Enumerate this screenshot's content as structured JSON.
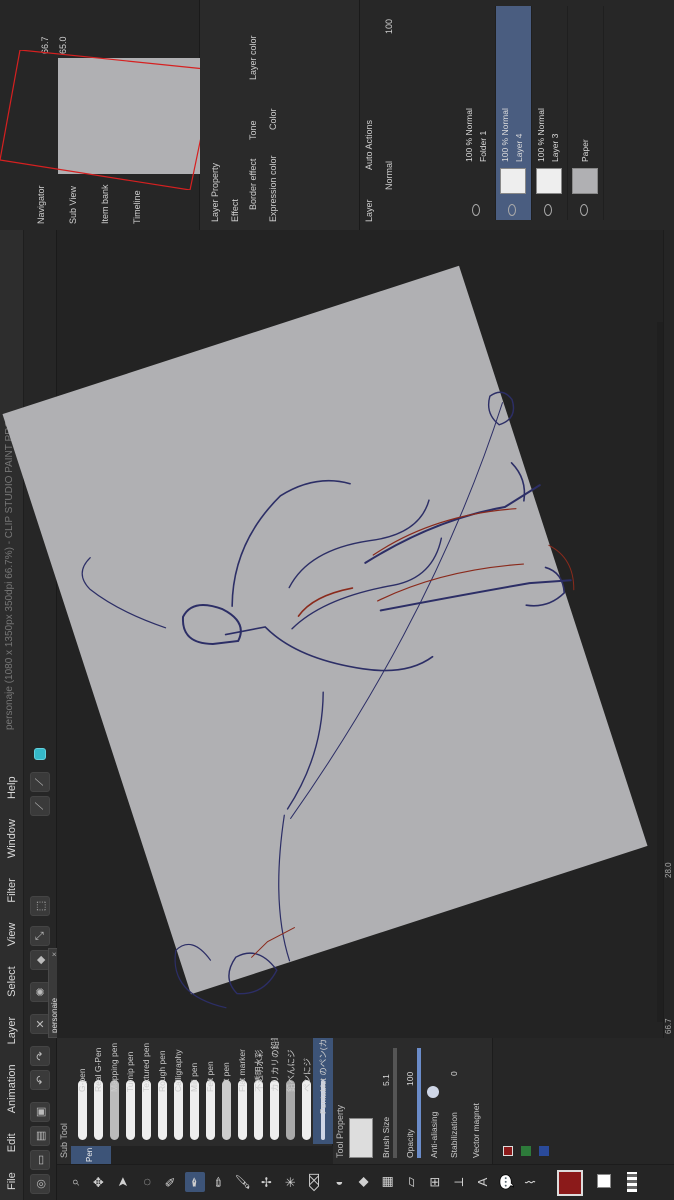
{
  "app": {
    "title": "personaje (1080 x 1350px 350dpi 66.7%)  - CLIP STUDIO PAINT PRO"
  },
  "menu": [
    "File",
    "Edit",
    "Animation",
    "Layer",
    "Select",
    "View",
    "Filter",
    "Window",
    "Help"
  ],
  "document_tab": "personaje",
  "subtool": {
    "tab_label": "Sub Tool",
    "pen_tab": "Pen",
    "brushes": [
      "G-pen",
      "Real G-Pen",
      "Mapping pen",
      "Turnip pen",
      "Textured pen",
      "Rough pen",
      "Calligraphy",
      "Mili pen",
      "Felt pen",
      "Dot pen",
      "Flat marker",
      "不透明水彩",
      "カリカリの鉛筆",
      "鉛べんにジ",
      "ペンにジ",
      "Pentablet のペン(カスタム)"
    ]
  },
  "tool_property": {
    "title": "Tool Property",
    "brush_size_label": "Brush Size",
    "brush_size_value": "5.1",
    "opacity_label": "Opacity",
    "opacity_value": "100",
    "anti_alias_label": "Anti-aliasing",
    "stabilization_label": "Stabilization",
    "stabilization_value": "0",
    "vector_magnet_label": "Vector magnet"
  },
  "status": {
    "zoom": "66.7",
    "angle": "28.0",
    "bottom_size": "5.1",
    "bottom_opacity": "100"
  },
  "navigator": {
    "tabs": [
      "Navigator",
      "Sub View",
      "Item bank",
      "Timeline"
    ],
    "zoom": "66.7",
    "angle": "65.0"
  },
  "layer_property": {
    "title": "Layer Property",
    "effect_label": "Effect",
    "border_effect": "Border effect",
    "tone": "Tone",
    "layer_color": "Layer color",
    "expression_color_label": "Expression color",
    "color": "Color"
  },
  "layers": {
    "tabs": [
      "Layer",
      "Auto Actions"
    ],
    "blend_mode": "Normal",
    "opacity": "100",
    "items": [
      {
        "name": "Folder 1",
        "mode": "100 % Normal"
      },
      {
        "name": "Layer 4",
        "mode": "100 % Normal"
      },
      {
        "name": "Layer 3",
        "mode": "100 % Normal"
      },
      {
        "name": "Paper",
        "mode": ""
      }
    ]
  },
  "colors": {
    "accent": "#4a5d80",
    "cyan_swatch": "#35b8c8",
    "main_color": "#8b1a1a",
    "paper": "#b0b0b3",
    "sketch_blue": "#2c2e66",
    "sketch_red": "#8a2a1c"
  }
}
